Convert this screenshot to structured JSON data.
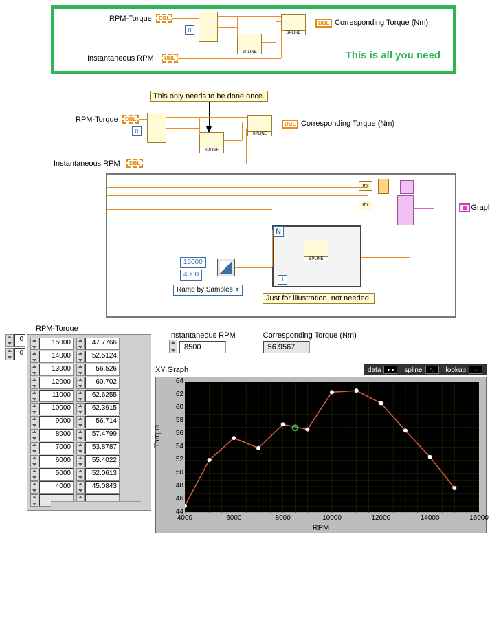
{
  "diagram1": {
    "rpm_torque_label": "RPM-Torque",
    "dbl_array": "DBL",
    "idx_const": "0",
    "inst_rpm_label": "Instantaneous RPM",
    "dbl_scalar": "DBL",
    "out_label": "Corresponding Torque (Nm)",
    "annot": "This is all you need"
  },
  "diagram2": {
    "tip_text": "This only needs to be done once.",
    "rpm_torque_label": "RPM-Torque",
    "inst_rpm_label": "Instantaneous RPM",
    "out_label": "Corresponding Torque (Nm)",
    "const_hi": "15000",
    "const_lo": "4000",
    "ramp_ring": "Ramp by Samples",
    "illus_tip": "Just for illustration, not needed.",
    "xy_label": "XY Graph",
    "loop_N": "N",
    "loop_i": "i"
  },
  "fp": {
    "table_label": "RPM-Torque",
    "row_idx": "0",
    "col_idx": "0",
    "rows": [
      {
        "rpm": "15000",
        "tq": "47.7766"
      },
      {
        "rpm": "14000",
        "tq": "52.5124"
      },
      {
        "rpm": "13000",
        "tq": "56.526"
      },
      {
        "rpm": "12000",
        "tq": "60.702"
      },
      {
        "rpm": "11000",
        "tq": "62.6255"
      },
      {
        "rpm": "10000",
        "tq": "62.3915"
      },
      {
        "rpm": "9000",
        "tq": "56.714"
      },
      {
        "rpm": "8000",
        "tq": "57.4799"
      },
      {
        "rpm": "7000",
        "tq": "53.8787"
      },
      {
        "rpm": "6000",
        "tq": "55.4022"
      },
      {
        "rpm": "5000",
        "tq": "52.0613"
      },
      {
        "rpm": "4000",
        "tq": "45.0843"
      }
    ],
    "inst_rpm_label": "Instantaneous RPM",
    "inst_rpm_val": "8500",
    "out_label": "Corresponding Torque (Nm)",
    "out_val": "56.9567"
  },
  "graph": {
    "title": "XY Graph",
    "legend": {
      "data": "data",
      "spline": "spline",
      "lookup": "lookup"
    },
    "ylabel": "Torque",
    "xlabel": "RPM"
  },
  "chart_data": {
    "type": "scatter+line",
    "xlabel": "RPM",
    "ylabel": "Torque",
    "xlim": [
      4000,
      16000
    ],
    "ylim": [
      44,
      64
    ],
    "xticks": [
      4000,
      6000,
      8000,
      10000,
      12000,
      14000,
      16000
    ],
    "yticks": [
      44,
      46,
      48,
      50,
      52,
      54,
      56,
      58,
      60,
      62,
      64
    ],
    "series": [
      {
        "name": "data",
        "style": "points-white",
        "x": [
          4000,
          5000,
          6000,
          7000,
          8000,
          9000,
          10000,
          11000,
          12000,
          13000,
          14000,
          15000
        ],
        "y": [
          45.0843,
          52.0613,
          55.4022,
          53.8787,
          57.4799,
          56.714,
          62.3915,
          62.6255,
          60.702,
          56.526,
          52.5124,
          47.7766
        ]
      },
      {
        "name": "spline",
        "style": "line-red",
        "x": [
          4000,
          5000,
          6000,
          7000,
          8000,
          9000,
          10000,
          11000,
          12000,
          13000,
          14000,
          15000
        ],
        "y": [
          45.08,
          52.06,
          55.4,
          53.88,
          57.48,
          56.71,
          62.39,
          62.63,
          60.7,
          56.53,
          52.51,
          47.78
        ]
      },
      {
        "name": "lookup",
        "style": "point-green-circle",
        "x": [
          8500
        ],
        "y": [
          56.9567
        ]
      }
    ]
  }
}
